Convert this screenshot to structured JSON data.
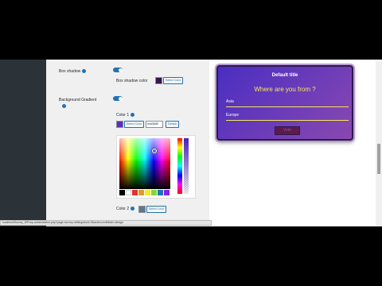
{
  "settings": {
    "box_shadow_label": "Box shadow",
    "box_shadow_color_label": "Box shadow color",
    "select_color_label": "Select Color",
    "background_gradient_label": "Background Gradient",
    "color1_label": "Color 1",
    "color1_hex": "#4a38d8",
    "default_label": "Default",
    "color2_label": "Color 2",
    "color2_select_label": "Select Color",
    "box_shadow_swatch": "#3a1450",
    "color1_swatch": "#5a2fc0",
    "color2_swatch": "#5b7a8f"
  },
  "palette": [
    "#000000",
    "#ffffff",
    "#dd3333",
    "#dd9933",
    "#eeee22",
    "#81d742",
    "#1e73be",
    "#8224e3"
  ],
  "popup": {
    "title": "Default title",
    "question": "Where are you from ?",
    "options": [
      "Asia",
      "Europe"
    ],
    "button_label": "Vote"
  },
  "status_url": "localhost/Survey_WP/wp-admin/admin.php?page=survey-settings&sid=3&action=edit&tab=design"
}
